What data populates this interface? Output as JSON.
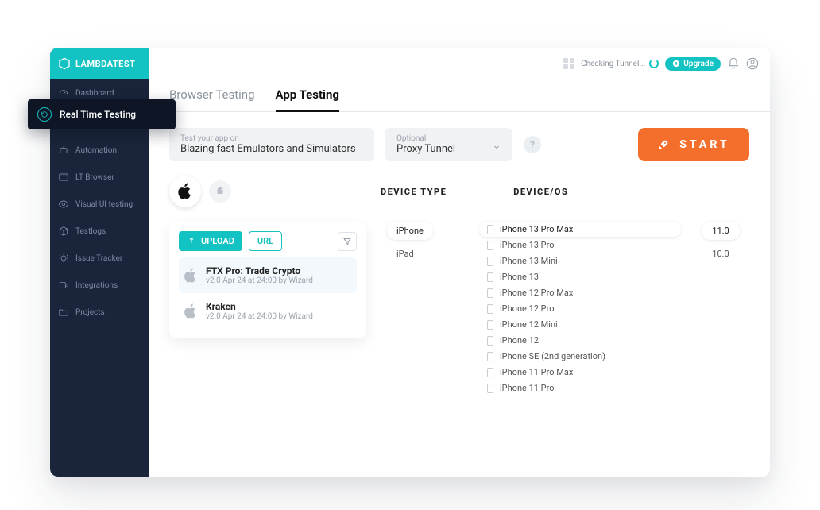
{
  "brand": "LAMBDATEST",
  "topbar": {
    "tunnel_status": "Checking Tunnel...",
    "upgrade": "Upgrade"
  },
  "sidebar": {
    "items": [
      {
        "label": "Dashboard"
      },
      {
        "label": "Real Time Testing"
      },
      {
        "label": "Automation"
      },
      {
        "label": "LT Browser"
      },
      {
        "label": "Visual UI testing"
      },
      {
        "label": "Testlogs"
      },
      {
        "label": "Issue Tracker"
      },
      {
        "label": "Integrations"
      },
      {
        "label": "Projects"
      }
    ]
  },
  "tabs": {
    "browser": "Browser Testing",
    "app": "App Testing"
  },
  "controls": {
    "app_label": "Test your app on",
    "app_value": "Blazing fast Emulators and Simulators",
    "proxy_label": "Optional",
    "proxy_value": "Proxy Tunnel",
    "start": "START"
  },
  "headers": {
    "device_type": "DEVICE TYPE",
    "device_os": "DEVICE/OS"
  },
  "upload": {
    "upload_btn": "UPLOAD",
    "url_btn": "URL",
    "apps": [
      {
        "name": "FTX Pro: Trade Crypto",
        "sub": "v2.0 Apr 24 at 24:00 by Wizard"
      },
      {
        "name": "Kraken",
        "sub": "v2.0 Apr 24 at 24:00 by Wizard"
      }
    ]
  },
  "device_types": [
    "iPhone",
    "iPad"
  ],
  "devices": [
    "iPhone 13 Pro Max",
    "iPhone 13 Pro",
    "iPhone 13 Mini",
    "iPhone 13",
    "iPhone 12 Pro Max",
    "iPhone 12 Pro",
    "iPhone 12 Mini",
    "iPhone 12",
    "iPhone SE (2nd generation)",
    "iPhone 11 Pro Max",
    "iPhone 11 Pro"
  ],
  "os_versions": [
    "11.0",
    "10.0"
  ]
}
